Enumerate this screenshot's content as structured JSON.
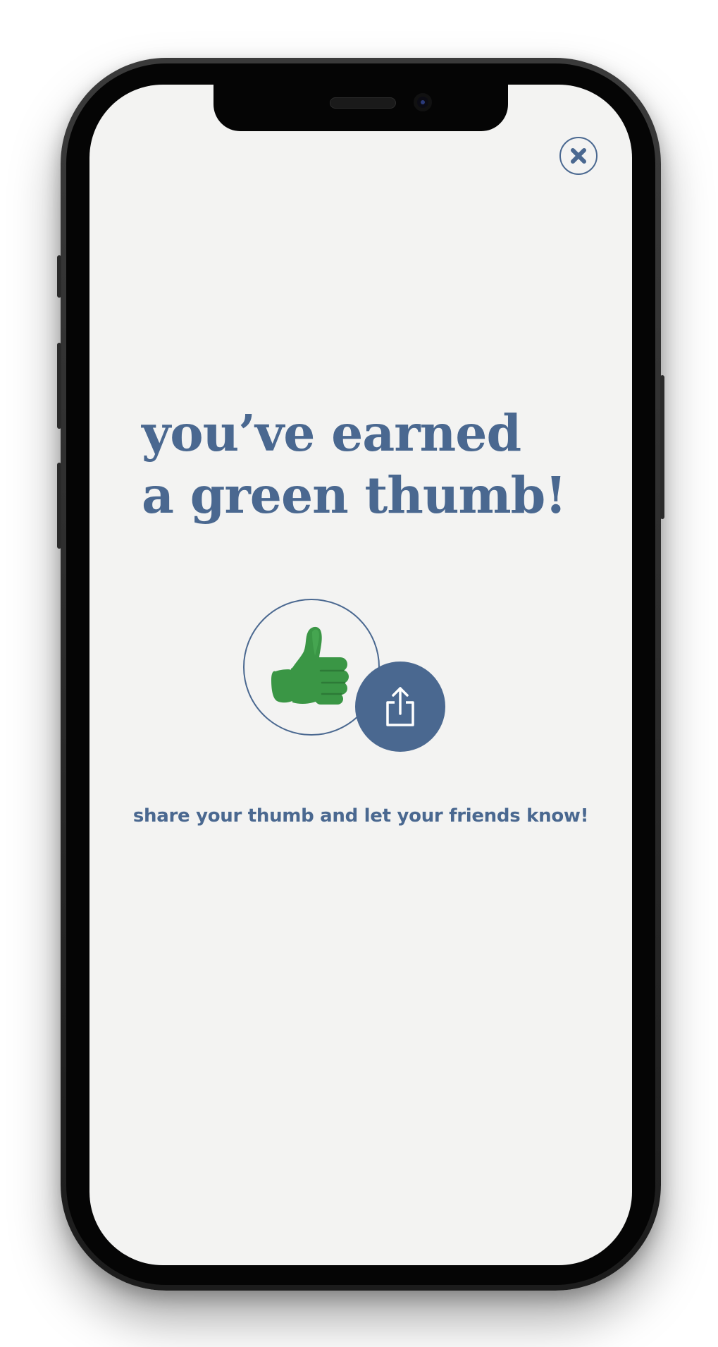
{
  "screen": {
    "headline_line1": "you’ve earned",
    "headline_line2": "a green thumb!",
    "share_caption": "share your thumb and let your friends know!"
  },
  "icons": {
    "close": "close-icon",
    "badge": "thumbs-up-icon",
    "share": "share-icon"
  },
  "colors": {
    "accent": "#4a6890",
    "screen_background": "#f3f3f2",
    "thumb_green": "#3a9645"
  }
}
